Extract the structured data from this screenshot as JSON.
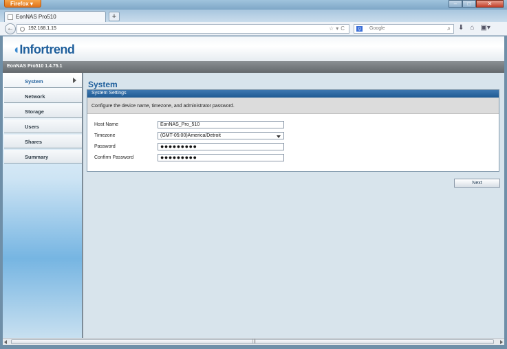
{
  "browser": {
    "menu_button_label": "Firefox",
    "tab_title": "EonNAS Pro510",
    "new_tab_label": "+",
    "url": "192.168.1.15",
    "search_placeholder": "Google"
  },
  "app": {
    "logo_text": "Infortrend",
    "version_label": "EonNAS Pro510 1.4.75.1"
  },
  "sidebar": {
    "items": [
      {
        "label": "System",
        "active": true
      },
      {
        "label": "Network"
      },
      {
        "label": "Storage"
      },
      {
        "label": "Users"
      },
      {
        "label": "Shares"
      },
      {
        "label": "Summary"
      }
    ]
  },
  "main": {
    "title": "System",
    "panel_title": "System Settings",
    "description": "Configure the device name, timezone, and administrator password.",
    "fields": {
      "host_name": {
        "label": "Host Name",
        "value": "EonNAS_Pro_510"
      },
      "timezone": {
        "label": "Timezone",
        "value": "(GMT-05:00)America/Detroit"
      },
      "password": {
        "label": "Password",
        "value": "●●●●●●●●●"
      },
      "confirm_password": {
        "label": "Confirm Password",
        "value": "●●●●●●●●●"
      }
    },
    "next_label": "Next"
  },
  "colors": {
    "brand_blue": "#1f5f9c",
    "panel_header": "#2a659e"
  }
}
